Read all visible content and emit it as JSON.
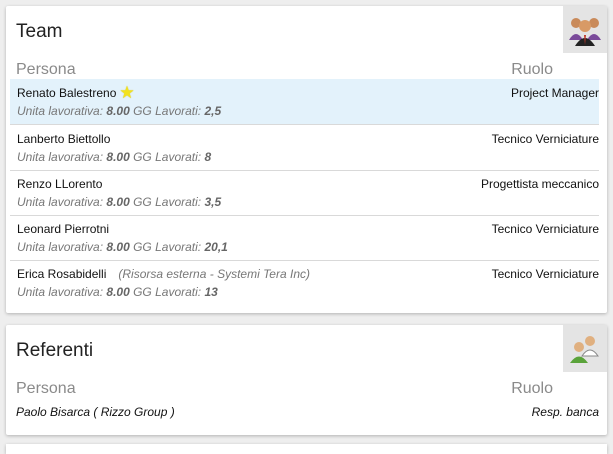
{
  "team": {
    "title": "Team",
    "col_person": "Persona",
    "col_role": "Ruolo",
    "icon": "team-group-icon",
    "members": [
      {
        "name": "Renato Balestreno",
        "external": "",
        "role": "Project Manager",
        "unit_label": "Unita lavorativa:",
        "unit_value": "8.00",
        "days_label": "GG Lavorati:",
        "days_value": "2,5",
        "starred": true
      },
      {
        "name": "Lanberto Biettollo",
        "external": "",
        "role": "Tecnico Verniciature",
        "unit_label": "Unita lavorativa:",
        "unit_value": "8.00",
        "days_label": "GG Lavorati:",
        "days_value": "8",
        "starred": false
      },
      {
        "name": "Renzo LLorento",
        "external": "",
        "role": "Progettista meccanico",
        "unit_label": "Unita lavorativa:",
        "unit_value": "8.00",
        "days_label": "GG Lavorati:",
        "days_value": "3,5",
        "starred": false
      },
      {
        "name": "Leonard Pierrotni",
        "external": "",
        "role": "Tecnico Verniciature",
        "unit_label": "Unita lavorativa:",
        "unit_value": "8.00",
        "days_label": "GG Lavorati:",
        "days_value": "20,1",
        "starred": false
      },
      {
        "name": "Erica Rosabidelli",
        "external": "(Risorsa esterna - Systemi Tera Inc)",
        "role": "Tecnico Verniciature",
        "unit_label": "Unita lavorativa:",
        "unit_value": "8.00",
        "days_label": "GG Lavorati:",
        "days_value": "13",
        "starred": false
      }
    ],
    "star_symbol": "★"
  },
  "referenti": {
    "title": "Referenti",
    "col_person": "Persona",
    "col_role": "Ruolo",
    "icon": "contacts-icon",
    "items": [
      {
        "name": "Paolo Bisarca ( Rizzo Group )",
        "role": "Resp. banca"
      }
    ]
  }
}
